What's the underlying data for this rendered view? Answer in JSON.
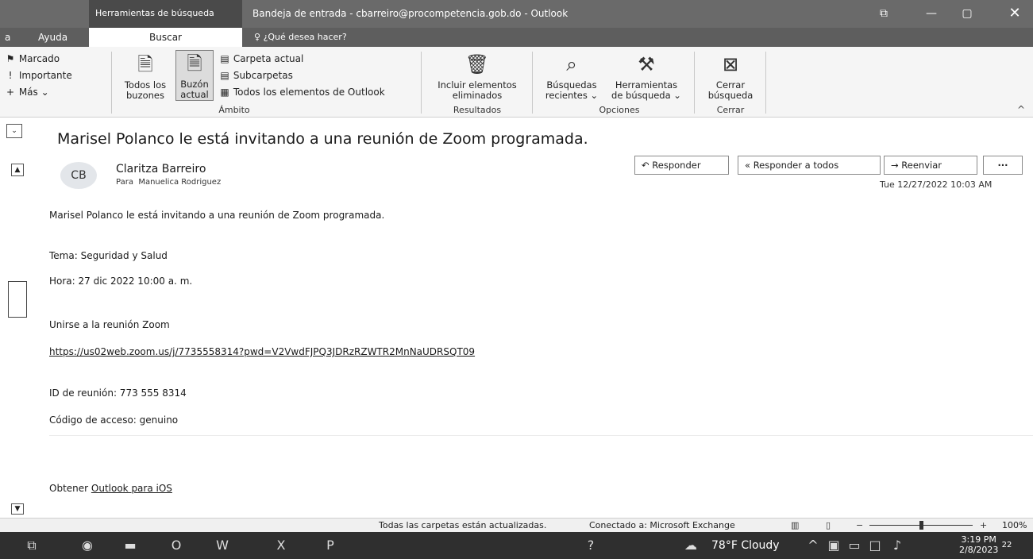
{
  "titlebar": {
    "context_tab": "Herramientas de búsqueda",
    "title": "Bandeja de entrada - cbarreiro@procompetencia.gob.do  -  Outlook",
    "restore_icon": "⧉",
    "minimize_icon": "—",
    "maximize_icon": "▢",
    "close_icon": "✕"
  },
  "tabs": {
    "a": "a",
    "ayuda": "Ayuda",
    "buscar": "Buscar",
    "tellme_icon": "♀",
    "tellme": "¿Qué desea hacer?"
  },
  "ribbon": {
    "marcado": "Marcado",
    "importante": "Importante",
    "mas": "Más ⌄",
    "todos_buzones_1": "Todos los",
    "todos_buzones_2": "buzones",
    "buzon_actual_1": "Buzón",
    "buzon_actual_2": "actual",
    "carpeta_actual": "Carpeta actual",
    "subcarpetas": "Subcarpetas",
    "todos_elementos": "Todos los elementos de Outlook",
    "ambito": "Ámbito",
    "incluir_1": "Incluir elementos",
    "incluir_2": "eliminados",
    "resultados": "Resultados",
    "busquedas_1": "Búsquedas",
    "busquedas_2": "recientes ⌄",
    "herramientas_1": "Herramientas",
    "herramientas_2": "de búsqueda ⌄",
    "opciones": "Opciones",
    "cerrar_1": "Cerrar",
    "cerrar_2": "búsqueda",
    "cerrar_group": "Cerrar",
    "collapse": "^"
  },
  "message": {
    "subject": "Marisel Polanco le está invitando a una reunión de Zoom programada.",
    "avatar": "CB",
    "sender": "Claritza Barreiro",
    "to_label": "Para",
    "to": "Manuelica Rodriguez",
    "reply": "Responder",
    "reply_all": "Responder a todos",
    "forward": "Reenviar",
    "more": "···",
    "timestamp": "Tue 12/27/2022 10:03 AM",
    "body_intro": "Marisel Polanco le está invitando a una reunión de Zoom programada.",
    "tema": "Tema: Seguridad y Salud",
    "hora": "Hora: 27 dic 2022 10:00 a. m.",
    "unirse": "Unirse a la reunión Zoom",
    "link": "https://us02web.zoom.us/j/7735558314?pwd=V2VwdFJPQ3JDRzRZWTR2MnNaUDRSQT09",
    "meeting_id": "ID de reunión: 773 555 8314",
    "access_code": "Código de acceso: genuino",
    "obtener": "Obtener",
    "outlook_ios": "Outlook para iOS"
  },
  "status": {
    "folders": "Todas las carpetas están actualizadas.",
    "connected": "Conectado a: Microsoft Exchange",
    "zoom": "100%",
    "zoom_level": 1.0
  },
  "taskbar": {
    "weather": "78°F  Cloudy",
    "time": "3:19 PM",
    "date": "2/8/2023",
    "notifications": "22"
  }
}
